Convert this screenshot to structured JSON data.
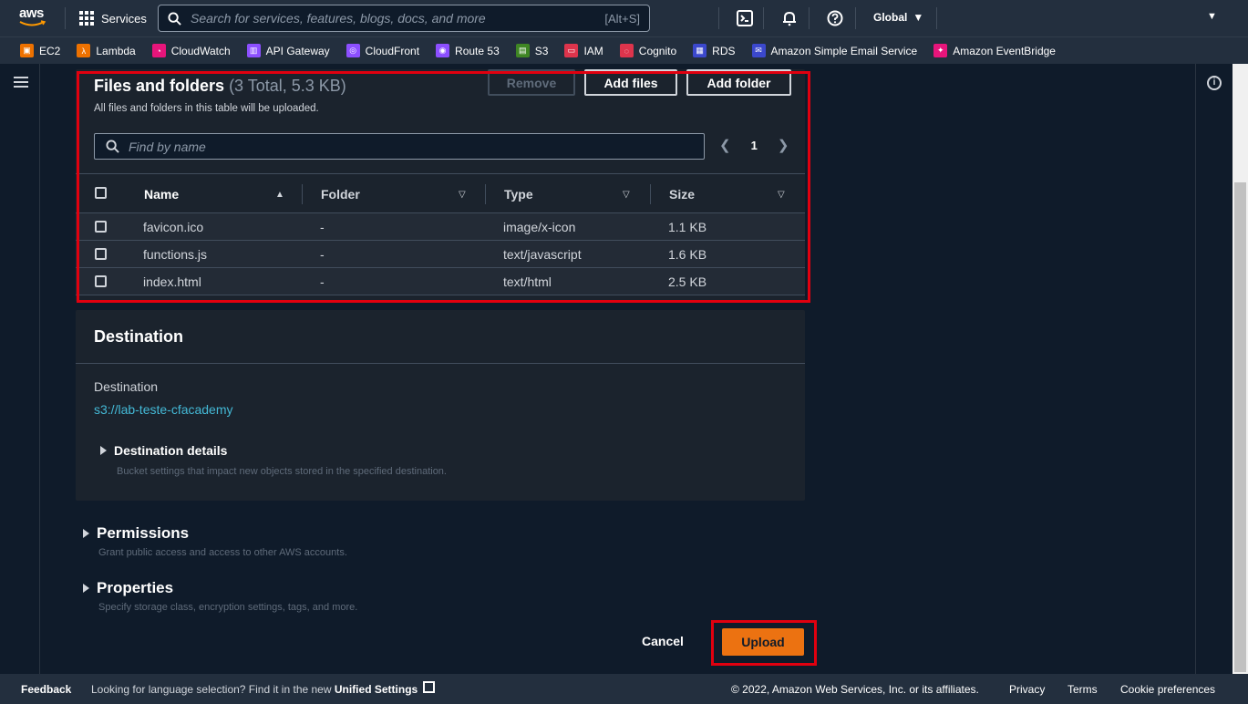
{
  "nav": {
    "logo_text": "aws",
    "services_label": "Services",
    "search_placeholder": "Search for services, features, blogs, docs, and more",
    "search_shortcut": "[Alt+S]",
    "region": "Global"
  },
  "favorites": [
    {
      "label": "EC2",
      "color": "#ed7100"
    },
    {
      "label": "Lambda",
      "color": "#ed7100"
    },
    {
      "label": "CloudWatch",
      "color": "#e7157b"
    },
    {
      "label": "API Gateway",
      "color": "#8c4fff"
    },
    {
      "label": "CloudFront",
      "color": "#8c4fff"
    },
    {
      "label": "Route 53",
      "color": "#8c4fff"
    },
    {
      "label": "S3",
      "color": "#3f8624"
    },
    {
      "label": "IAM",
      "color": "#dd344c"
    },
    {
      "label": "Cognito",
      "color": "#dd344c"
    },
    {
      "label": "RDS",
      "color": "#3b48cc"
    },
    {
      "label": "Amazon Simple Email Service",
      "color": "#3b48cc"
    },
    {
      "label": "Amazon EventBridge",
      "color": "#e7157b"
    }
  ],
  "files": {
    "title": "Files and folders",
    "count": "(3 Total, 5.3 KB)",
    "description": "All files and folders in this table will be uploaded.",
    "remove_label": "Remove",
    "add_files_label": "Add files",
    "add_folder_label": "Add folder",
    "find_placeholder": "Find by name",
    "page": "1",
    "columns": [
      "Name",
      "Folder",
      "Type",
      "Size"
    ],
    "rows": [
      {
        "name": "favicon.ico",
        "folder": "-",
        "type": "image/x-icon",
        "size": "1.1 KB"
      },
      {
        "name": "functions.js",
        "folder": "-",
        "type": "text/javascript",
        "size": "1.6 KB"
      },
      {
        "name": "index.html",
        "folder": "-",
        "type": "text/html",
        "size": "2.5 KB"
      }
    ]
  },
  "destination": {
    "title": "Destination",
    "label": "Destination",
    "link": "s3://lab-teste-cfacademy",
    "details_label": "Destination details",
    "details_desc": "Bucket settings that impact new objects stored in the specified destination."
  },
  "permissions": {
    "label": "Permissions",
    "desc": "Grant public access and access to other AWS accounts."
  },
  "properties": {
    "label": "Properties",
    "desc": "Specify storage class, encryption settings, tags, and more."
  },
  "actions": {
    "cancel_label": "Cancel",
    "upload_label": "Upload"
  },
  "footer": {
    "feedback": "Feedback",
    "lang_msg": "Looking for language selection? Find it in the new",
    "unified_settings": "Unified Settings",
    "copyright": "© 2022, Amazon Web Services, Inc. or its affiliates.",
    "privacy": "Privacy",
    "terms": "Terms",
    "cookie": "Cookie preferences"
  }
}
